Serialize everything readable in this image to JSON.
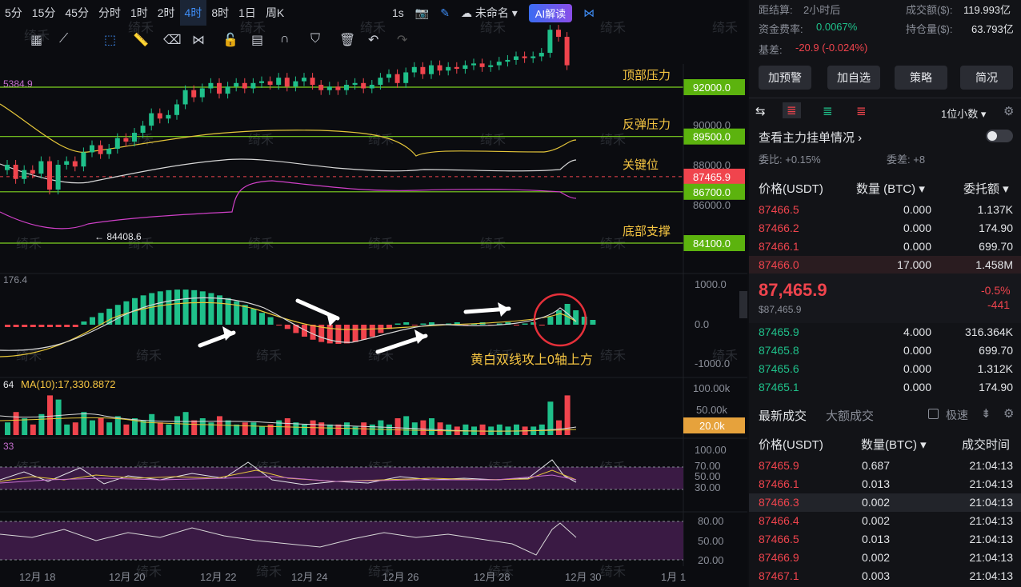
{
  "topbar": {
    "timeframes": [
      "5分",
      "15分",
      "45分",
      "分时",
      "1时",
      "2时",
      "4时",
      "8时",
      "1日",
      "周K"
    ],
    "active": "4时",
    "right_label": "1s",
    "layout_name": "未命名",
    "ai_label": "AI解读"
  },
  "chart_labels": {
    "top_left_value": "5384.9",
    "macd_label": "176.4",
    "vol_label": "64",
    "vol_ma": "MA(10):17,330.8872",
    "rsi_label": "33"
  },
  "price_levels": [
    {
      "label": "顶部压力",
      "price": "92000.0",
      "value": 92000
    },
    {
      "label": "反弹压力",
      "price": "89500.0",
      "value": 89500
    },
    {
      "label": "关键位",
      "price": "87465.9",
      "value": 87465.9,
      "current": true
    },
    {
      "label": "",
      "price": "86700.0",
      "value": 86700
    },
    {
      "label": "底部支撑",
      "price": "84100.0",
      "value": 84100
    }
  ],
  "price_axis": [
    "90000.0",
    "88000.0",
    "86000.0"
  ],
  "low_marker": "← 84408.6",
  "macd_axis": [
    "1000.0",
    "0.0",
    "-1000.0"
  ],
  "macd_annotation": "黄白双线攻上0轴上方",
  "vol_axis": [
    "100.00k",
    "50.00k",
    "20.0k"
  ],
  "rsi_axis": [
    "100.00",
    "70.00",
    "50.00",
    "30.00"
  ],
  "kdj_axis": [
    "80.00",
    "50.00",
    "20.00"
  ],
  "x_axis": [
    "12月 18",
    "12月 20",
    "12月 22",
    "12月 24",
    "12月 26",
    "12月 28",
    "12月 30",
    "1月 1"
  ],
  "watermark": "绮禾",
  "right": {
    "stats": [
      {
        "k": "距结算:",
        "v": "2小时后"
      },
      {
        "k": "成交额($):",
        "v": "119.993亿"
      },
      {
        "k": "资金费率:",
        "v": "0.0067%"
      },
      {
        "k": "持仓量($):",
        "v": "63.793亿"
      },
      {
        "k": "基差:",
        "v": "-20.9 (-0.024%)"
      }
    ],
    "buttons": [
      "加预警",
      "加自选",
      "策略",
      "简况"
    ],
    "decimal": "1位小数",
    "main_orders": "查看主力挂单情况",
    "ratio": "委比: +0.15%",
    "diff": "委差: +8",
    "ob_headers": [
      "价格(USDT)",
      "数量 (BTC)",
      "委托额"
    ],
    "asks": [
      [
        "87466.5",
        "0.000",
        "1.137K"
      ],
      [
        "87466.2",
        "0.000",
        "174.90"
      ],
      [
        "87466.1",
        "0.000",
        "699.70"
      ],
      [
        "87466.0",
        "17.000",
        "1.458M"
      ]
    ],
    "last_price": "87,465.9",
    "last_usd": "$87,465.9",
    "change_pct": "-0.5%",
    "change_abs": "-441",
    "bids": [
      [
        "87465.9",
        "4.000",
        "316.364K"
      ],
      [
        "87465.8",
        "0.000",
        "699.70"
      ],
      [
        "87465.6",
        "0.000",
        "1.312K"
      ],
      [
        "87465.1",
        "0.000",
        "174.90"
      ]
    ],
    "trade_tabs": [
      "最新成交",
      "大额成交"
    ],
    "fast_label": "极速",
    "trade_headers": [
      "价格(USDT)",
      "数量(BTC)",
      "成交时间"
    ],
    "trades": [
      [
        "87465.9",
        "0.687",
        "21:04:13"
      ],
      [
        "87466.1",
        "0.013",
        "21:04:13"
      ],
      [
        "87466.3",
        "0.002",
        "21:04:13"
      ],
      [
        "87466.4",
        "0.002",
        "21:04:13"
      ],
      [
        "87466.5",
        "0.013",
        "21:04:13"
      ],
      [
        "87466.9",
        "0.002",
        "21:04:13"
      ],
      [
        "87467.1",
        "0.003",
        "21:04:13"
      ]
    ]
  },
  "colors": {
    "up": "#1fc08a",
    "down": "#f0444d",
    "level": "#7ed321",
    "accent": "#3f8df5"
  }
}
